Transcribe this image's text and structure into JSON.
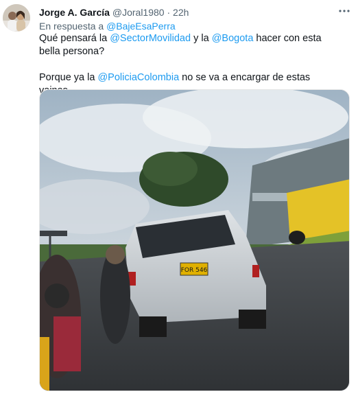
{
  "tweet": {
    "author_name": "Jorge A. García",
    "handle": "@Joral1980",
    "separator": "·",
    "time": "22h",
    "reply_prefix": "En respuesta a",
    "reply_to": "@BajeEsaPerra",
    "text_parts": {
      "p1_a": "Qué pensará la ",
      "m1": "@SectorMovilidad",
      "p1_b": " y la ",
      "m2": "@Bogota",
      "p1_c": " hacer con esta bella persona?",
      "p2_a": "Porque ya la ",
      "m3": "@PoliciaColombia",
      "p2_b": " no se va a encargar de estas vainas..."
    },
    "more_icon": "more-horizontal-icon",
    "media": {
      "plate_text": "FOR 546"
    }
  },
  "colors": {
    "link": "#1d9bf0",
    "secondary_text": "#536471",
    "primary_text": "#0f1419"
  }
}
